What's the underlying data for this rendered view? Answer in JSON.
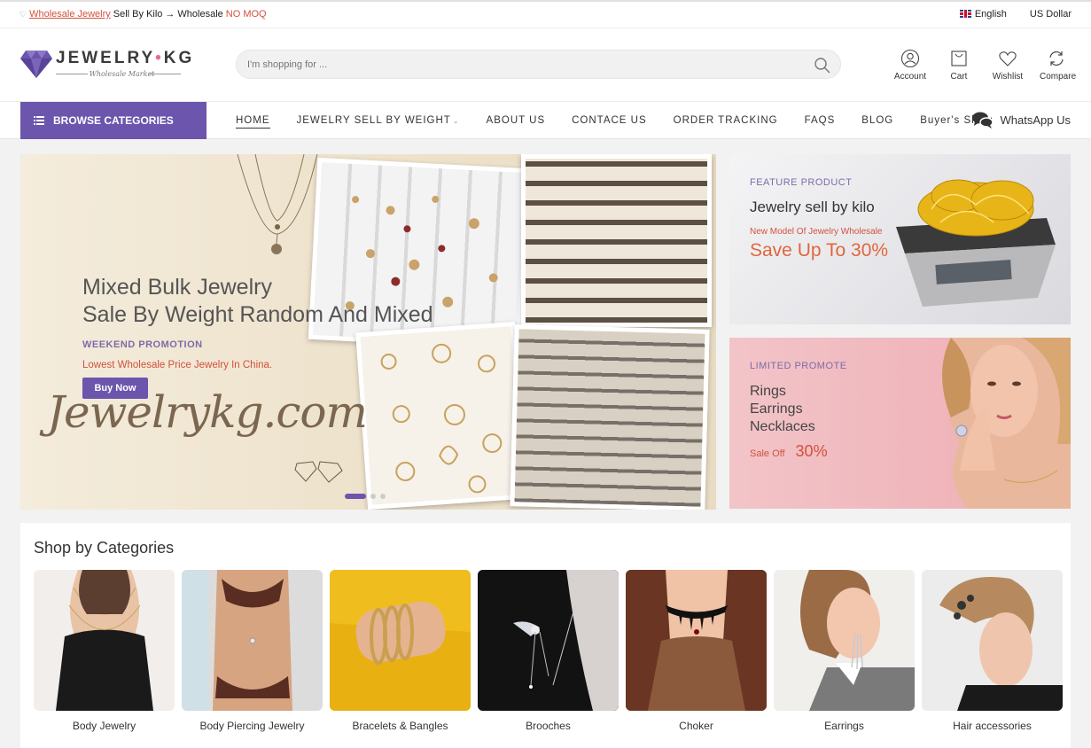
{
  "topbar": {
    "promo_link": "Wholesale Jewelry",
    "promo_mid": "Sell By Kilo",
    "promo_wholesale": "Wholesale",
    "promo_red": "NO MOQ",
    "language": "English",
    "currency": "US Dollar"
  },
  "header": {
    "logo_word": "JEWELRY",
    "logo_dot": "•",
    "logo_word2": "KG",
    "logo_sub": "Wholesale Market",
    "search_placeholder": "I'm shopping for ...",
    "icons": [
      {
        "label": "Account",
        "icon": "user-icon"
      },
      {
        "label": "Cart",
        "icon": "cart-icon"
      },
      {
        "label": "Wishlist",
        "icon": "heart-icon"
      },
      {
        "label": "Compare",
        "icon": "refresh-icon"
      }
    ]
  },
  "nav": {
    "browse": "Browse Categories",
    "items": [
      "HOME",
      "JEWELRY SELL BY WEIGHT",
      "ABOUT US",
      "CONTACE US",
      "ORDER TRACKING",
      "FAQS",
      "BLOG",
      "Buyer's Show"
    ],
    "whatsapp": "WhatsApp Us"
  },
  "hero": {
    "title_line1": "Mixed Bulk Jewelry",
    "title_line2": "Sale By Weight Random And Mixed",
    "promo": "WEEKEND PROMOTION",
    "subtitle": "Lowest Wholesale Price Jewelry In China.",
    "button": "Buy Now",
    "script": "Jewelrykg.com"
  },
  "side1": {
    "tag": "FEATURE PRODUCT",
    "title": "Jewelry sell by kilo",
    "subtitle": "New Model Of Jewelry Wholesale",
    "offer": "Save Up To 30%"
  },
  "side2": {
    "tag": "LIMITED PROMOTE",
    "lines": [
      "Rings",
      "Earrings",
      "Necklaces"
    ],
    "sale_label": "Sale Off",
    "sale_pct": "30%"
  },
  "categories": {
    "title": "Shop by Categories",
    "items": [
      "Body Jewelry",
      "Body Piercing Jewelry",
      "Bracelets & Bangles",
      "Brooches",
      "Choker",
      "Earrings",
      "Hair accessories"
    ]
  },
  "colors": {
    "brand": "#6b55ad",
    "accent": "#d2513d"
  }
}
